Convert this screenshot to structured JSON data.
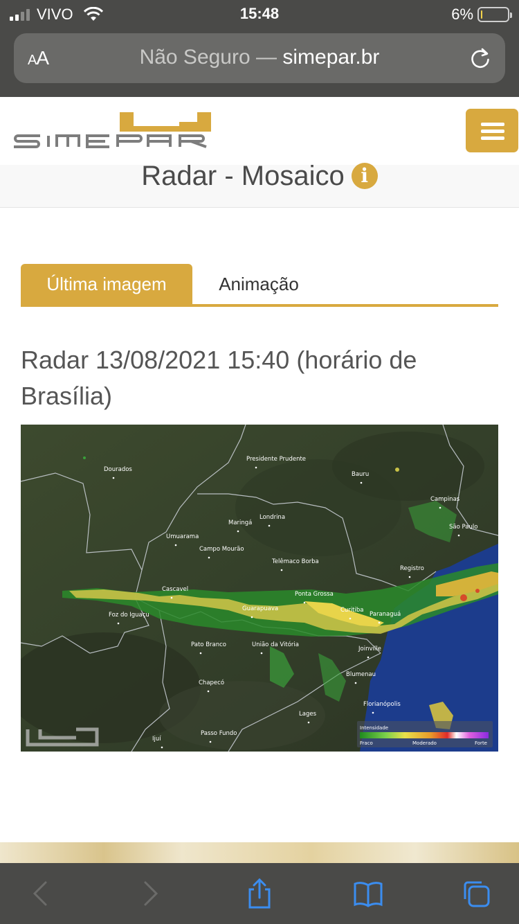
{
  "status_bar": {
    "carrier": "VIVO",
    "time": "15:48",
    "battery": "6%",
    "battery_level": 0.06
  },
  "browser": {
    "text_size_label": "AA",
    "url_insecure": "Não Seguro —",
    "url_domain": "simepar.br"
  },
  "site": {
    "logo_text": "SIMEPAR",
    "page_title": "Radar - Mosaico"
  },
  "tabs": [
    {
      "label": "Última imagem",
      "active": true
    },
    {
      "label": "Animação",
      "active": false
    }
  ],
  "radar": {
    "heading": "Radar 13/08/2021 15:40 (horário de Brasília)",
    "cities": [
      "Dourados",
      "Presidente Prudente",
      "Bauru",
      "Campinas",
      "São Paulo",
      "Maringá",
      "Londrina",
      "Umuarama",
      "Campo Mourão",
      "Telêmaco Borba",
      "Registro",
      "Cascavel",
      "Ponta Grossa",
      "Guarapuava",
      "Curitiba",
      "Paranaguá",
      "Foz do Iguaçu",
      "Pato Branco",
      "União da Vitória",
      "Joinville",
      "Blumenau",
      "Chapecó",
      "Florianópolis",
      "Lages",
      "Passo Fundo",
      "Ijuí"
    ],
    "legend": {
      "title": "Intensidade",
      "low": "Fraco",
      "mid": "Moderado",
      "high": "Forte"
    }
  },
  "colors": {
    "accent": "#d8a93f",
    "browser_chrome": "#4a4a48",
    "ocean": "#1c3c8c"
  }
}
